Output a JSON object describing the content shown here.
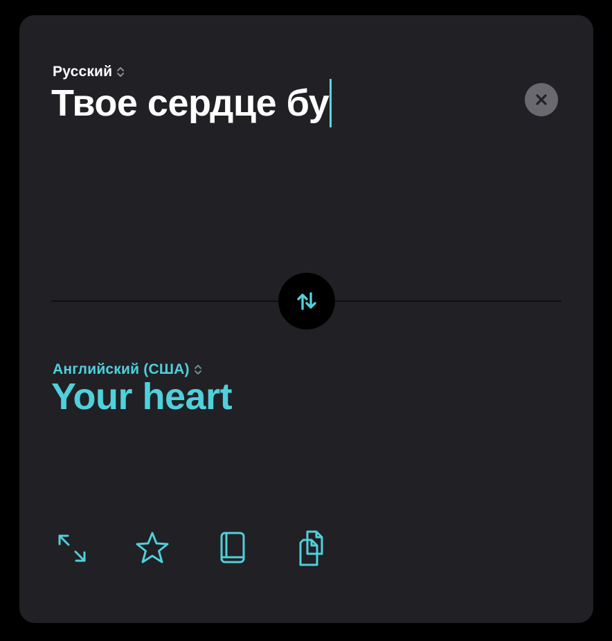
{
  "source": {
    "language": "Русский",
    "text": "Твое сердце бу"
  },
  "target": {
    "language": "Английский (США)",
    "text": "Your heart"
  },
  "icons": {
    "source_lang_selector": "chevron-up-down-icon",
    "target_lang_selector": "chevron-up-down-icon",
    "clear": "close-icon",
    "swap": "swap-arrows-icon",
    "toolbar": [
      "expand-icon",
      "star-icon",
      "book-icon",
      "copy-icon"
    ]
  },
  "colors": {
    "background": "#000000",
    "card": "#212025",
    "accent": "#4fd1dc",
    "source_text": "#ffffff",
    "clear_button": "#6a6970"
  }
}
